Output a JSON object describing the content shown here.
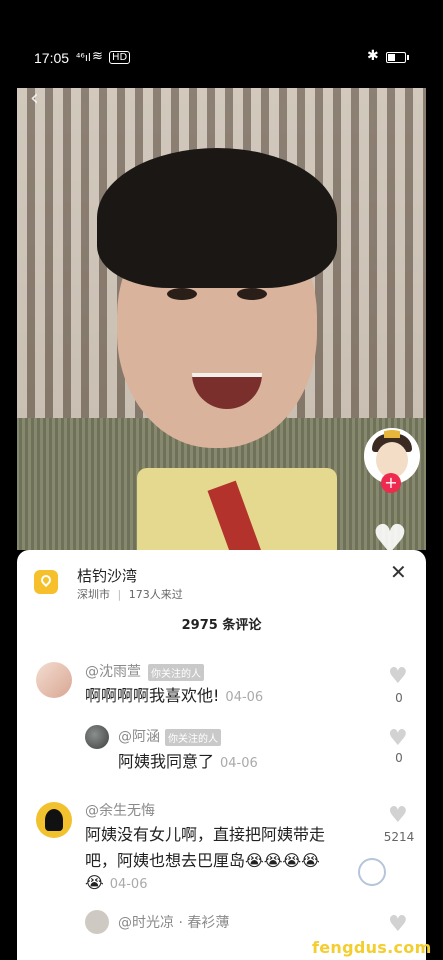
{
  "status_bar": {
    "time": "17:05",
    "signal": "⁴⁶ıl",
    "wifi": "≋",
    "hd": "HD",
    "bluetooth": "✱",
    "battery_level": 0.4
  },
  "location": {
    "title": "桔钓沙湾",
    "city": "深圳市",
    "separator": "|",
    "visitors": "173人来过"
  },
  "comments_header": "2975 条评论",
  "comments": [
    {
      "name": "@沈雨萱",
      "tag": "你关注的人",
      "text": "啊啊啊啊我喜欢他!",
      "time": "04-06",
      "likes": "0"
    },
    {
      "name": "@阿涵",
      "tag": "你关注的人",
      "text": "阿姨我同意了",
      "time": "04-06",
      "likes": "0"
    },
    {
      "name": "@余生无悔",
      "text_line1": "阿姨没有女儿啊，直接把阿姨带走",
      "text_line2": "吧，阿姨也想去巴厘岛😭😭😭😭",
      "text_line3": "😭",
      "time": "04-06",
      "likes": "5214"
    }
  ],
  "partial_name": "@时光凉 · 春衫薄",
  "watermark": "fengdus.com",
  "icons": {
    "back": "‹",
    "close": "✕",
    "heart": "♥",
    "plus": "+"
  }
}
